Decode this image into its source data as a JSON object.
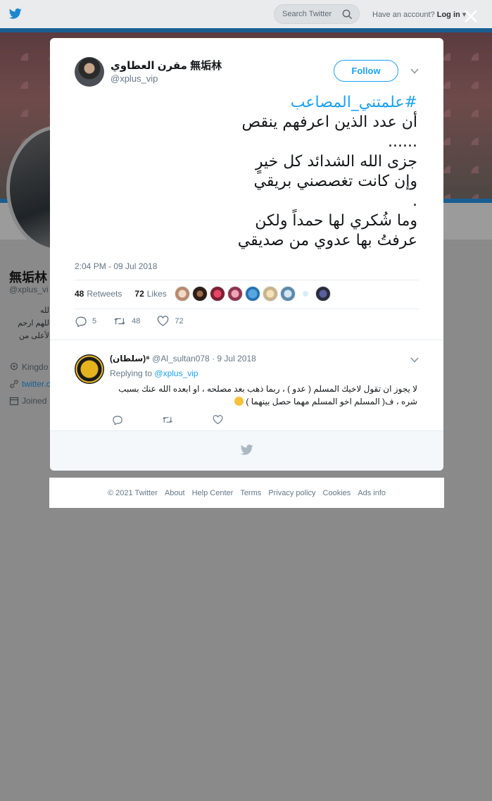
{
  "background": {
    "search_placeholder": "Search Twitter",
    "account_prompt": "Have an account?",
    "login_label": "Log in",
    "profile_name": "無垢林",
    "profile_handle": "@xplus_vi",
    "bio_lines": [
      "الله",
      "اللهم ارحم",
      "الأعلى من"
    ],
    "meta": {
      "location": "Kingdo",
      "link": "twitter.c",
      "joined": "Joined"
    },
    "colors": {
      "accent": "#1da1f2",
      "header_bar": "#195e93"
    }
  },
  "modal": {
    "author": {
      "name": "مقرن العطاوي 無垢林",
      "handle": "@xplus_vip",
      "follow_label": "Follow"
    },
    "tweet": {
      "hashtag": "#علمتني_المصاعب",
      "lines": [
        "أن عدد الذين اعرفهم ينقص",
        "......",
        "جزى الله الشدائد كل خيرٍ",
        "وإن كانت تغصصني بريقي",
        ".",
        "وما شُكري لها حمداً ولكن",
        "عرفتُ بها عدوي من صديقي"
      ],
      "timestamp": "2:04 PM - 09 Jul 2018",
      "retweets_count": "48",
      "retweets_label": "Retweets",
      "likes_count": "72",
      "likes_label": "Likes",
      "action_counts": {
        "replies": "5",
        "retweets": "48",
        "likes": "72"
      }
    },
    "reply": {
      "name": "(سلطان)⁸",
      "handle": "@Al_sultan078",
      "date": "· 9 Jul 2018",
      "replying_prefix": "Replying to",
      "replying_handle": "@xplus_vip",
      "text_line1": "لا يجوز ان تقول لاخيك المسلم ( عدو ) ، ربما ذهب بعد مصلحه ، او ابعده الله عنك بسبب",
      "text_line2": "شره ، ف( المسلم اخو المسلم مهما حصل بينهما )"
    }
  },
  "footer": {
    "items": [
      "© 2021 Twitter",
      "About",
      "Help Center",
      "Terms",
      "Privacy policy",
      "Cookies",
      "Ads info"
    ]
  }
}
